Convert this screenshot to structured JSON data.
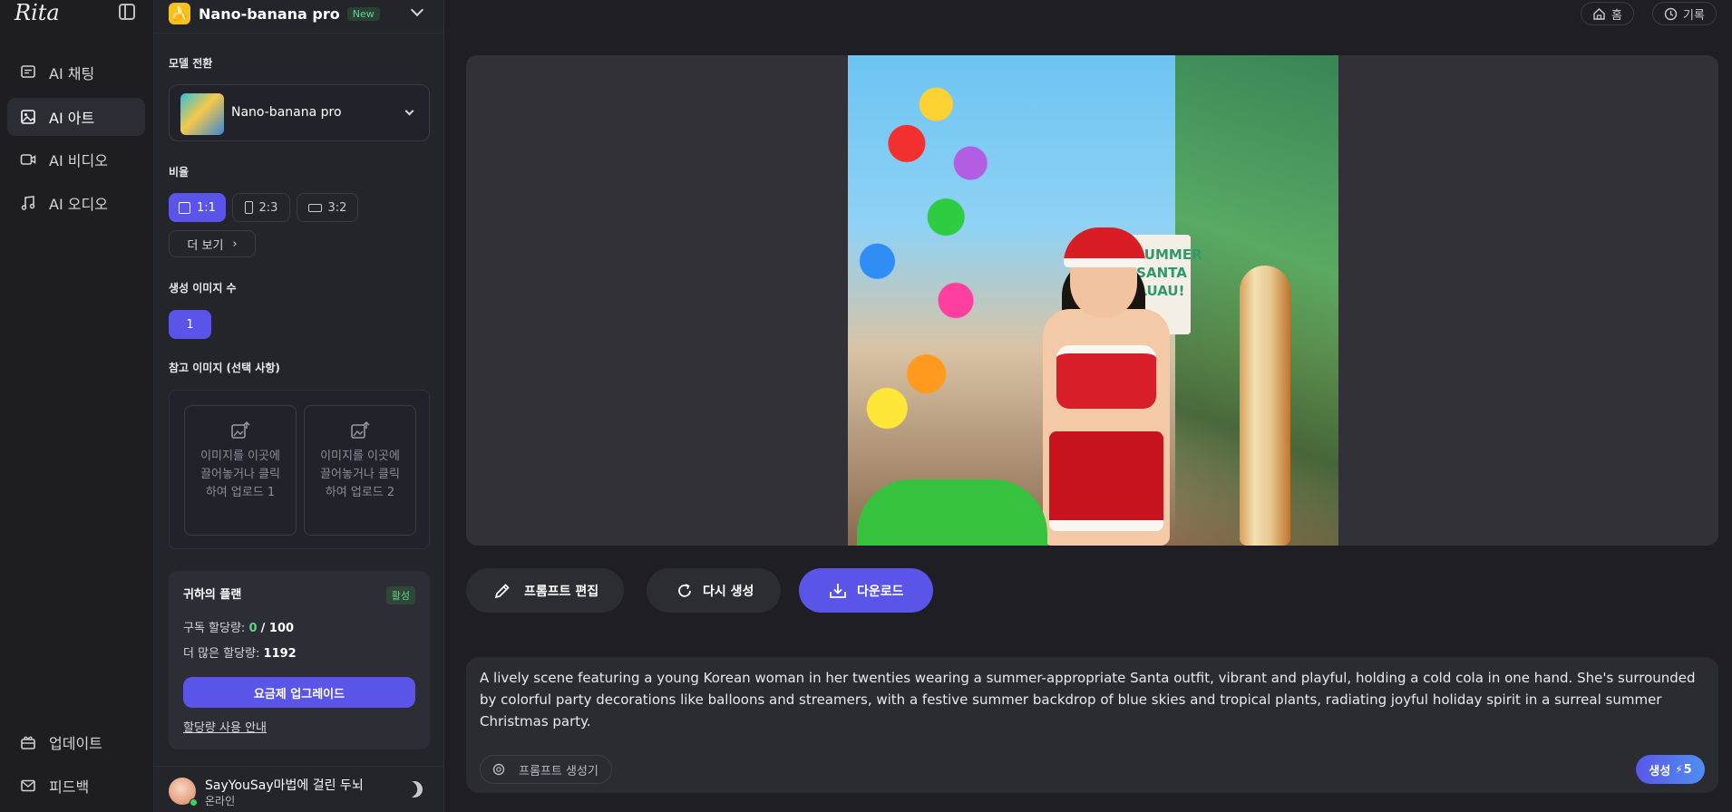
{
  "app": {
    "logo": "Rita"
  },
  "nav": {
    "items": [
      {
        "label": "AI 채팅",
        "icon": "chat-icon"
      },
      {
        "label": "AI 아트",
        "icon": "image-icon",
        "active": true
      },
      {
        "label": "AI 비디오",
        "icon": "video-icon"
      },
      {
        "label": "AI 오디오",
        "icon": "music-icon"
      }
    ],
    "bottom": [
      {
        "label": "업데이트",
        "icon": "gift-icon"
      },
      {
        "label": "피드백",
        "icon": "mail-icon"
      }
    ]
  },
  "model_header": {
    "name": "Nano-banana pro",
    "badge": "New"
  },
  "settings": {
    "model_switch_label": "모델 전환",
    "model_name": "Nano-banana pro",
    "ratio_label": "비율",
    "ratios": [
      "1:1",
      "2:3",
      "3:2"
    ],
    "selected_ratio": "1:1",
    "more_label": "더 보기",
    "count_label": "생성 이미지 수",
    "count_value": "1",
    "ref_label": "참고 이미지 (선택 사항)",
    "uploads": [
      "이미지를 이곳에 끌어놓거나 클릭하여 업로드 1",
      "이미지를 이곳에 끌어놓거나 클릭하여 업로드 2"
    ]
  },
  "plan": {
    "title": "귀하의 플랜",
    "status": "활성",
    "sub_label": "구독 할당량:",
    "sub_used": "0",
    "sub_total": "/ 100",
    "more_label": "더 많은 할당량:",
    "more_value": "1192",
    "upgrade_label": "요금제 업그레이드",
    "guide_link": "할당량 사용 안내"
  },
  "user": {
    "name": "SayYouSay마법에 걸린 두뇌",
    "status": "온라인"
  },
  "top_bar": {
    "home": "홈",
    "history": "기록"
  },
  "image": {
    "sign_text": "SUMMER SANTA LUAU!"
  },
  "actions": {
    "edit_prompt": "프롬프트 편집",
    "regenerate": "다시 생성",
    "download": "다운로드"
  },
  "prompt": {
    "text": "A lively scene featuring a young Korean woman in her twenties wearing a summer-appropriate Santa outfit, vibrant and playful, holding a cold cola in one hand. She's surrounded by colorful party decorations like balloons and streamers, with a festive summer backdrop of blue skies and tropical plants, radiating joyful holiday spirit in a surreal summer Christmas party.",
    "helper_label": "프롬프트 생성기",
    "generate_label": "생성",
    "generate_cost": "5"
  },
  "colors": {
    "accent": "#5a55e8",
    "active_green": "#5fd38d",
    "background": "#1e1e24"
  }
}
